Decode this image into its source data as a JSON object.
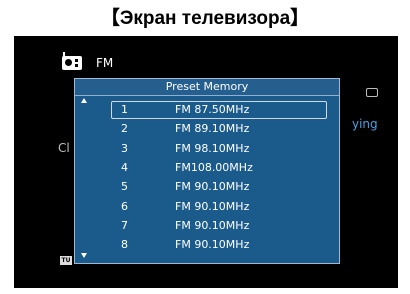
{
  "caption": "【Экран телевизора】",
  "background": {
    "source_label": "FM",
    "left_text": "Cl",
    "right_text": "ying",
    "tu_badge": "TU"
  },
  "panel": {
    "title": "Preset Memory",
    "selected_index": 0,
    "presets": [
      {
        "num": "1",
        "freq": "FM 87.50MHz"
      },
      {
        "num": "2",
        "freq": "FM 89.10MHz"
      },
      {
        "num": "3",
        "freq": "FM 98.10MHz"
      },
      {
        "num": "4",
        "freq": "FM108.00MHz"
      },
      {
        "num": "5",
        "freq": "FM 90.10MHz"
      },
      {
        "num": "6",
        "freq": "FM 90.10MHz"
      },
      {
        "num": "7",
        "freq": "FM 90.10MHz"
      },
      {
        "num": "8",
        "freq": "FM 90.10MHz"
      }
    ]
  },
  "colors": {
    "panel_bg": "#1b5b8c",
    "accent_text": "#4aa0e0"
  }
}
